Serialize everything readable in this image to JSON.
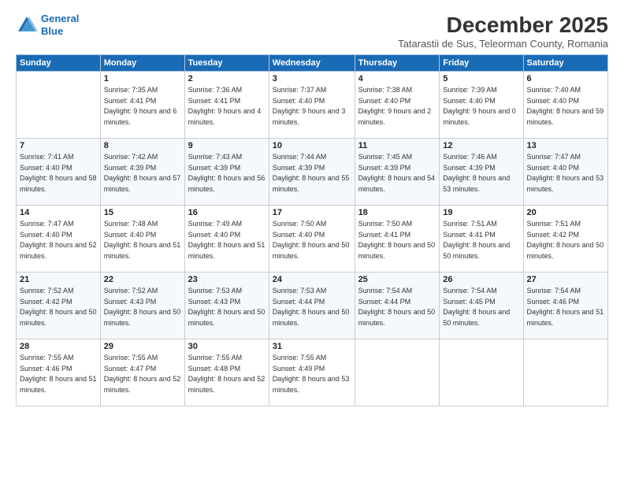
{
  "logo": {
    "line1": "General",
    "line2": "Blue"
  },
  "title": "December 2025",
  "subtitle": "Tatarastii de Sus, Teleorman County, Romania",
  "weekdays": [
    "Sunday",
    "Monday",
    "Tuesday",
    "Wednesday",
    "Thursday",
    "Friday",
    "Saturday"
  ],
  "weeks": [
    [
      {
        "day": "",
        "sunrise": "",
        "sunset": "",
        "daylight": ""
      },
      {
        "day": "1",
        "sunrise": "Sunrise: 7:35 AM",
        "sunset": "Sunset: 4:41 PM",
        "daylight": "Daylight: 9 hours and 6 minutes."
      },
      {
        "day": "2",
        "sunrise": "Sunrise: 7:36 AM",
        "sunset": "Sunset: 4:41 PM",
        "daylight": "Daylight: 9 hours and 4 minutes."
      },
      {
        "day": "3",
        "sunrise": "Sunrise: 7:37 AM",
        "sunset": "Sunset: 4:40 PM",
        "daylight": "Daylight: 9 hours and 3 minutes."
      },
      {
        "day": "4",
        "sunrise": "Sunrise: 7:38 AM",
        "sunset": "Sunset: 4:40 PM",
        "daylight": "Daylight: 9 hours and 2 minutes."
      },
      {
        "day": "5",
        "sunrise": "Sunrise: 7:39 AM",
        "sunset": "Sunset: 4:40 PM",
        "daylight": "Daylight: 9 hours and 0 minutes."
      },
      {
        "day": "6",
        "sunrise": "Sunrise: 7:40 AM",
        "sunset": "Sunset: 4:40 PM",
        "daylight": "Daylight: 8 hours and 59 minutes."
      }
    ],
    [
      {
        "day": "7",
        "sunrise": "Sunrise: 7:41 AM",
        "sunset": "Sunset: 4:40 PM",
        "daylight": "Daylight: 8 hours and 58 minutes."
      },
      {
        "day": "8",
        "sunrise": "Sunrise: 7:42 AM",
        "sunset": "Sunset: 4:39 PM",
        "daylight": "Daylight: 8 hours and 57 minutes."
      },
      {
        "day": "9",
        "sunrise": "Sunrise: 7:43 AM",
        "sunset": "Sunset: 4:39 PM",
        "daylight": "Daylight: 8 hours and 56 minutes."
      },
      {
        "day": "10",
        "sunrise": "Sunrise: 7:44 AM",
        "sunset": "Sunset: 4:39 PM",
        "daylight": "Daylight: 8 hours and 55 minutes."
      },
      {
        "day": "11",
        "sunrise": "Sunrise: 7:45 AM",
        "sunset": "Sunset: 4:39 PM",
        "daylight": "Daylight: 8 hours and 54 minutes."
      },
      {
        "day": "12",
        "sunrise": "Sunrise: 7:46 AM",
        "sunset": "Sunset: 4:39 PM",
        "daylight": "Daylight: 8 hours and 53 minutes."
      },
      {
        "day": "13",
        "sunrise": "Sunrise: 7:47 AM",
        "sunset": "Sunset: 4:40 PM",
        "daylight": "Daylight: 8 hours and 53 minutes."
      }
    ],
    [
      {
        "day": "14",
        "sunrise": "Sunrise: 7:47 AM",
        "sunset": "Sunset: 4:40 PM",
        "daylight": "Daylight: 8 hours and 52 minutes."
      },
      {
        "day": "15",
        "sunrise": "Sunrise: 7:48 AM",
        "sunset": "Sunset: 4:40 PM",
        "daylight": "Daylight: 8 hours and 51 minutes."
      },
      {
        "day": "16",
        "sunrise": "Sunrise: 7:49 AM",
        "sunset": "Sunset: 4:40 PM",
        "daylight": "Daylight: 8 hours and 51 minutes."
      },
      {
        "day": "17",
        "sunrise": "Sunrise: 7:50 AM",
        "sunset": "Sunset: 4:40 PM",
        "daylight": "Daylight: 8 hours and 50 minutes."
      },
      {
        "day": "18",
        "sunrise": "Sunrise: 7:50 AM",
        "sunset": "Sunset: 4:41 PM",
        "daylight": "Daylight: 8 hours and 50 minutes."
      },
      {
        "day": "19",
        "sunrise": "Sunrise: 7:51 AM",
        "sunset": "Sunset: 4:41 PM",
        "daylight": "Daylight: 8 hours and 50 minutes."
      },
      {
        "day": "20",
        "sunrise": "Sunrise: 7:51 AM",
        "sunset": "Sunset: 4:42 PM",
        "daylight": "Daylight: 8 hours and 50 minutes."
      }
    ],
    [
      {
        "day": "21",
        "sunrise": "Sunrise: 7:52 AM",
        "sunset": "Sunset: 4:42 PM",
        "daylight": "Daylight: 8 hours and 50 minutes."
      },
      {
        "day": "22",
        "sunrise": "Sunrise: 7:52 AM",
        "sunset": "Sunset: 4:43 PM",
        "daylight": "Daylight: 8 hours and 50 minutes."
      },
      {
        "day": "23",
        "sunrise": "Sunrise: 7:53 AM",
        "sunset": "Sunset: 4:43 PM",
        "daylight": "Daylight: 8 hours and 50 minutes."
      },
      {
        "day": "24",
        "sunrise": "Sunrise: 7:53 AM",
        "sunset": "Sunset: 4:44 PM",
        "daylight": "Daylight: 8 hours and 50 minutes."
      },
      {
        "day": "25",
        "sunrise": "Sunrise: 7:54 AM",
        "sunset": "Sunset: 4:44 PM",
        "daylight": "Daylight: 8 hours and 50 minutes."
      },
      {
        "day": "26",
        "sunrise": "Sunrise: 7:54 AM",
        "sunset": "Sunset: 4:45 PM",
        "daylight": "Daylight: 8 hours and 50 minutes."
      },
      {
        "day": "27",
        "sunrise": "Sunrise: 7:54 AM",
        "sunset": "Sunset: 4:46 PM",
        "daylight": "Daylight: 8 hours and 51 minutes."
      }
    ],
    [
      {
        "day": "28",
        "sunrise": "Sunrise: 7:55 AM",
        "sunset": "Sunset: 4:46 PM",
        "daylight": "Daylight: 8 hours and 51 minutes."
      },
      {
        "day": "29",
        "sunrise": "Sunrise: 7:55 AM",
        "sunset": "Sunset: 4:47 PM",
        "daylight": "Daylight: 8 hours and 52 minutes."
      },
      {
        "day": "30",
        "sunrise": "Sunrise: 7:55 AM",
        "sunset": "Sunset: 4:48 PM",
        "daylight": "Daylight: 8 hours and 52 minutes."
      },
      {
        "day": "31",
        "sunrise": "Sunrise: 7:55 AM",
        "sunset": "Sunset: 4:49 PM",
        "daylight": "Daylight: 8 hours and 53 minutes."
      },
      {
        "day": "",
        "sunrise": "",
        "sunset": "",
        "daylight": ""
      },
      {
        "day": "",
        "sunrise": "",
        "sunset": "",
        "daylight": ""
      },
      {
        "day": "",
        "sunrise": "",
        "sunset": "",
        "daylight": ""
      }
    ]
  ]
}
